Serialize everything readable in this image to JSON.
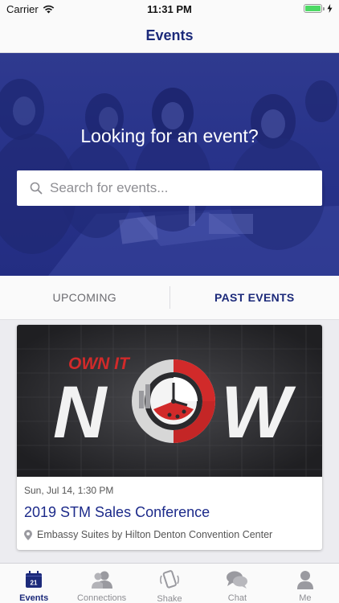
{
  "status_bar": {
    "carrier": "Carrier",
    "time": "11:31 PM",
    "icons": [
      "wifi-icon",
      "battery-icon",
      "charging-bolt-icon"
    ]
  },
  "nav": {
    "title": "Events"
  },
  "hero": {
    "heading": "Looking for an event?",
    "search": {
      "placeholder": "Search for events...",
      "value": "",
      "icon": "search-icon"
    }
  },
  "tabs": [
    {
      "label": "UPCOMING",
      "selected": false
    },
    {
      "label": "PAST EVENTS",
      "selected": true
    }
  ],
  "events": [
    {
      "image_text": {
        "tag": "OWN IT",
        "word": "NOW"
      },
      "date": "Sun, Jul 14, 1:30 PM",
      "title": "2019 STM Sales Conference",
      "location": "Embassy Suites by Hilton Denton Convention Center",
      "location_icon": "map-pin-icon"
    }
  ],
  "tab_bar": {
    "items": [
      {
        "label": "Events",
        "icon": "calendar-icon",
        "badge_day": "21",
        "active": true
      },
      {
        "label": "Connections",
        "icon": "people-icon",
        "active": false
      },
      {
        "label": "Shake",
        "icon": "shake-phone-icon",
        "active": false
      },
      {
        "label": "Chat",
        "icon": "chat-bubbles-icon",
        "active": false
      },
      {
        "label": "Me",
        "icon": "person-icon",
        "active": false
      }
    ]
  },
  "colors": {
    "brand": "#1c2a7a",
    "hero_overlay": "#28338a",
    "accent_red": "#d12a2a",
    "battery_green": "#4cd964"
  }
}
